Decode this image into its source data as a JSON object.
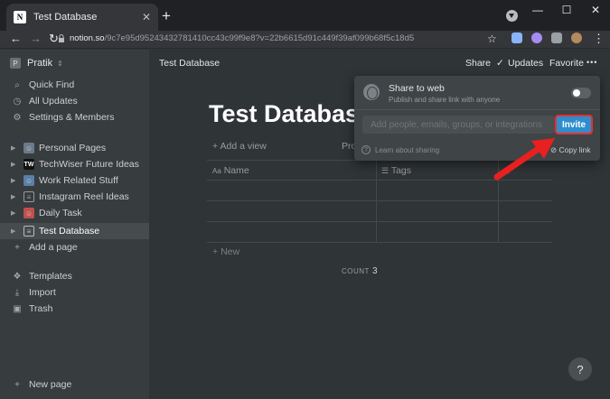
{
  "browser": {
    "tab_title": "Test Database",
    "tab_close": "✕",
    "new_tab": "+",
    "url_host": "notion.so",
    "url_path": "/9c7e95d95243432781410cc43c99f9e8?v=22b6615d91c449f39af099b68f5c18d5",
    "window_controls": [
      "⌄",
      "—",
      "☐",
      "✕"
    ],
    "nav": {
      "back": "←",
      "forward": "→",
      "reload": "↻",
      "lock": "🔒",
      "star": "☆",
      "menu": "⋮"
    }
  },
  "sidebar": {
    "workspace": "Pratik",
    "workspace_initial": "P",
    "top_items": [
      {
        "label": "Quick Find",
        "icon": "search-icon",
        "glyph": "🔍"
      },
      {
        "label": "All Updates",
        "icon": "clock-icon",
        "glyph": "◷"
      },
      {
        "label": "Settings & Members",
        "icon": "gear-icon",
        "glyph": "⚙"
      }
    ],
    "pages": [
      {
        "label": "Personal Pages",
        "icon": "avatar-icon",
        "glyph": "👤"
      },
      {
        "label": "TechWiser Future Ideas",
        "icon": "techwiser-logo-icon",
        "glyph": "TW"
      },
      {
        "label": "Work Related Stuff",
        "icon": "avatar-icon",
        "glyph": "👤"
      },
      {
        "label": "Instagram Reel Ideas",
        "icon": "page-icon",
        "glyph": "▤"
      },
      {
        "label": "Daily Task",
        "icon": "avatar-icon",
        "glyph": "👤"
      },
      {
        "label": "Test Database",
        "icon": "page-icon",
        "glyph": "▤"
      }
    ],
    "add_page": "Add a page",
    "bottom_items": [
      {
        "label": "Templates",
        "icon": "templates-icon",
        "glyph": "❖"
      },
      {
        "label": "Import",
        "icon": "import-icon",
        "glyph": "⤓"
      },
      {
        "label": "Trash",
        "icon": "trash-icon",
        "glyph": "🗑"
      }
    ],
    "new_page": "New page"
  },
  "main": {
    "breadcrumb": "Test Database",
    "share": "Share",
    "updates": "Updates",
    "favorite": "Favorite",
    "more": "•••",
    "title": "Test Database",
    "add_view": "Add a view",
    "properties_partial": "Pro",
    "columns": [
      {
        "label": "Name",
        "icon": "Aa"
      },
      {
        "label": "Tags",
        "icon": "☰"
      }
    ],
    "add_column": "+",
    "new_row": "New",
    "count_label": "COUNT",
    "count_value": "3",
    "help": "?"
  },
  "share_popup": {
    "title": "Share to web",
    "subtitle": "Publish and share link with anyone",
    "toggle_on": false,
    "invite_placeholder": "Add people, emails, groups, or integrations",
    "invite_button": "Invite",
    "learn": "Learn about sharing",
    "copy_link": "Copy link"
  },
  "colors": {
    "accent": "#2e8ecd",
    "annotation_arrow": "#e82020"
  }
}
